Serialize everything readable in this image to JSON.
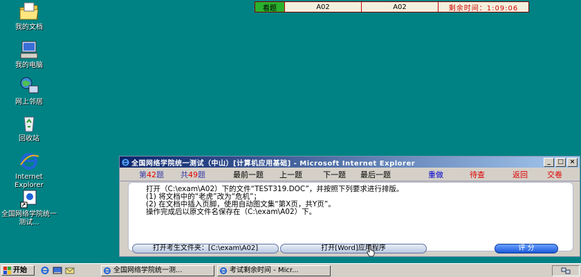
{
  "desktop": {
    "icons": [
      {
        "label": "我的文档"
      },
      {
        "label": "我的电脑"
      },
      {
        "label": "网上邻居"
      },
      {
        "label": "回收站"
      },
      {
        "label": "Internet Explorer"
      },
      {
        "label": "全国网络学院统一测试..."
      }
    ]
  },
  "timer_bar": {
    "look_label": "看题",
    "cell1": "A02",
    "cell2": "A02",
    "remaining": "剩余时间：1:09:06"
  },
  "exam_window": {
    "title": "全国网络学院统一测试（中山）[计算机应用基础] - Microsoft Internet Explorer",
    "nav": {
      "current_prefix": "第",
      "current_num": "42",
      "current_suffix": "题",
      "total_prefix": "共",
      "total_num": "49",
      "total_suffix": "题",
      "first": "最前一题",
      "prev": "上一题",
      "next": "下一题",
      "last": "最后一题",
      "redo": "重做",
      "pending": "待查",
      "back": "返回",
      "submit": "交卷"
    },
    "instructions": [
      "打开（C:\\exam\\A02）下的文件“TEST319.DOC”，并按照下列要求进行排版。",
      "(1) 将文档中的“老虎”改为“危机”；",
      "(2) 在文档中插入页脚，使用自动图文集“第X页，共Y页”。",
      "操作完成后以原文件名保存在（C:\\exam\\A02）下。"
    ],
    "buttons": {
      "open_folder": "打开考生文件夹：[C:\\exam\\A02]",
      "open_word": "打开[Word]应用程序",
      "score": "评 分"
    }
  },
  "taskbar": {
    "start": "开始",
    "tasks": [
      {
        "label": "全国网络学院统一测..."
      },
      {
        "label": "考试剩余时间 - Micr..."
      }
    ]
  },
  "colors": {
    "desktop": "#008284",
    "accent_red": "#e00000",
    "accent_blue": "#0000cc",
    "timer_green": "#2ab12e"
  }
}
